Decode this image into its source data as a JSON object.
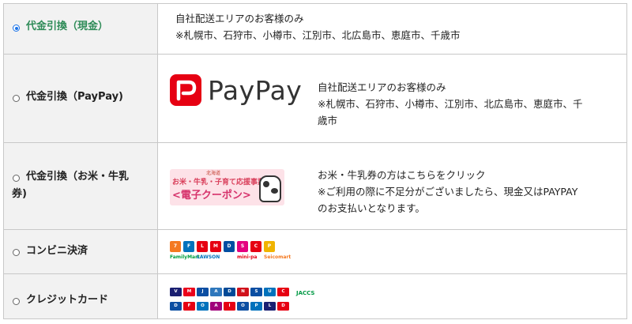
{
  "options": [
    {
      "label": "代金引換（現金）",
      "selected": true,
      "lines": [
        "自社配送エリアのお客様のみ",
        "※札幌市、石狩市、小樽市、江別市、北広島市、恵庭市、千歳市"
      ]
    },
    {
      "label": "代金引換（PayPay)",
      "selected": false,
      "logo_text": "PayPay",
      "lines": [
        "自社配送エリアのお客様のみ",
        "※札幌市、石狩市、小樽市、江別市、北広島市、恵庭市、千",
        "歳市"
      ]
    },
    {
      "label_lines": [
        "代金引換（お米・牛乳",
        "券)"
      ],
      "selected": false,
      "banner": {
        "small": "北海道",
        "top": "お米・牛乳・子育て応援事業",
        "main": "<電子クーポン>"
      },
      "lines": [
        "お米・牛乳券の方はこちらをクリック",
        "※ご利用の際に不足分がございましたら、現金又はPAYPAY",
        "のお支払いとなります。"
      ]
    },
    {
      "label": "コンビニ決済",
      "selected": false,
      "store_logos": [
        {
          "icon": "seven-eleven",
          "color": "#f47920",
          "glyph": "7"
        },
        {
          "icon": "familymart",
          "color": "#0072bc",
          "glyph": "F"
        },
        {
          "icon": "lawson",
          "color": "#e60012",
          "glyph": "L"
        },
        {
          "icon": "ministop",
          "color": "#e60012",
          "glyph": "M"
        },
        {
          "icon": "daily-yamazaki",
          "color": "#004ea2",
          "glyph": "D"
        },
        {
          "icon": "seicomart",
          "color": "#e4007f",
          "glyph": "S"
        },
        {
          "icon": "cocostore",
          "color": "#e60012",
          "glyph": "C"
        },
        {
          "icon": "poplar",
          "color": "#f0b400",
          "glyph": "P"
        }
      ],
      "store_captions": [
        {
          "text": "FamilyMart",
          "color": "#00a040"
        },
        {
          "text": "LAWSON",
          "color": "#0072bc"
        },
        {
          "text": "mini-pa",
          "color": "#e60012"
        },
        {
          "text": "Seicomart",
          "color": "#f47920"
        }
      ]
    },
    {
      "label": "クレジットカード",
      "selected": false,
      "cards_row1": [
        {
          "icon": "visa",
          "color": "#1a1f71",
          "glyph": "V"
        },
        {
          "icon": "mastercard",
          "color": "#eb001b",
          "glyph": "M"
        },
        {
          "icon": "jcb",
          "color": "#0b4ea2",
          "glyph": "J"
        },
        {
          "icon": "amex",
          "color": "#2e77bc",
          "glyph": "A"
        },
        {
          "icon": "diners",
          "color": "#004a97",
          "glyph": "D"
        },
        {
          "icon": "nicos",
          "color": "#d0121b",
          "glyph": "N"
        },
        {
          "icon": "saison",
          "color": "#0b4ea2",
          "glyph": "S"
        },
        {
          "icon": "uc",
          "color": "#0072bc",
          "glyph": "U"
        },
        {
          "icon": "dc",
          "color": "#e60012",
          "glyph": "C"
        }
      ],
      "cards_row1_caption": "JACCS",
      "cards_row2": [
        {
          "icon": "discover",
          "color": "#0b4ea2",
          "glyph": "D"
        },
        {
          "icon": "cf",
          "color": "#e60012",
          "glyph": "F"
        },
        {
          "icon": "orico",
          "color": "#0072bc",
          "glyph": "O"
        },
        {
          "icon": "aeon",
          "color": "#a0007a",
          "glyph": "A"
        },
        {
          "icon": "ic",
          "color": "#e60012",
          "glyph": "I"
        },
        {
          "icon": "omc",
          "color": "#0b4ea2",
          "glyph": "O"
        },
        {
          "icon": "pocket",
          "color": "#0072bc",
          "glyph": "P"
        },
        {
          "icon": "life",
          "color": "#1a1f71",
          "glyph": "L"
        },
        {
          "icon": "dc-card",
          "color": "#e60012",
          "glyph": "D"
        }
      ]
    }
  ]
}
